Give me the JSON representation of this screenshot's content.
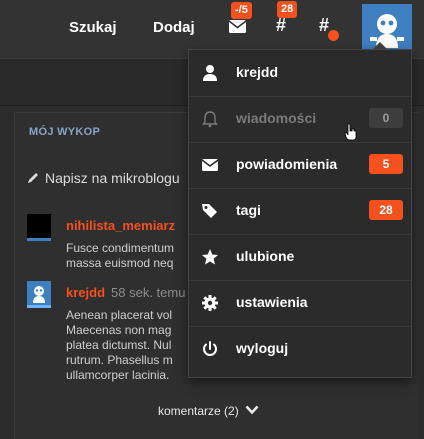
{
  "topbar": {
    "search_label": "Szukaj",
    "add_label": "Dodaj",
    "messages_badge": "-/5",
    "tags_badge": "28"
  },
  "panel": {
    "title": "MÓJ WYKOP",
    "write_placeholder": "Napisz na mikroblogu",
    "entries": [
      {
        "author": "nihilista_memiarz",
        "time": "",
        "lines": [
          "Fusce condimentum",
          "massa euismod neq"
        ]
      },
      {
        "author": "krejdd",
        "time": "58 sek. temu",
        "lines": [
          "Aenean placerat vol",
          "Maecenas non mag",
          "platea dictumst. Nul",
          "rutrum. Phasellus m",
          "ullamcorper lacinia."
        ]
      }
    ],
    "comments_label": "komentarze (2)"
  },
  "dropdown": {
    "items": [
      {
        "label": "krejdd",
        "icon": "user-icon",
        "badge": ""
      },
      {
        "label": "wiadomości",
        "icon": "bell-icon",
        "badge": "0"
      },
      {
        "label": "powiadomienia",
        "icon": "envelope-icon",
        "badge": "5"
      },
      {
        "label": "tagi",
        "icon": "tag-icon",
        "badge": "28"
      },
      {
        "label": "ulubione",
        "icon": "star-icon",
        "badge": ""
      },
      {
        "label": "ustawienia",
        "icon": "gear-icon",
        "badge": ""
      },
      {
        "label": "wyloguj",
        "icon": "power-icon",
        "badge": ""
      }
    ]
  },
  "colors": {
    "accent": "#f4511e",
    "avatar_blue": "#3d7fc1"
  }
}
